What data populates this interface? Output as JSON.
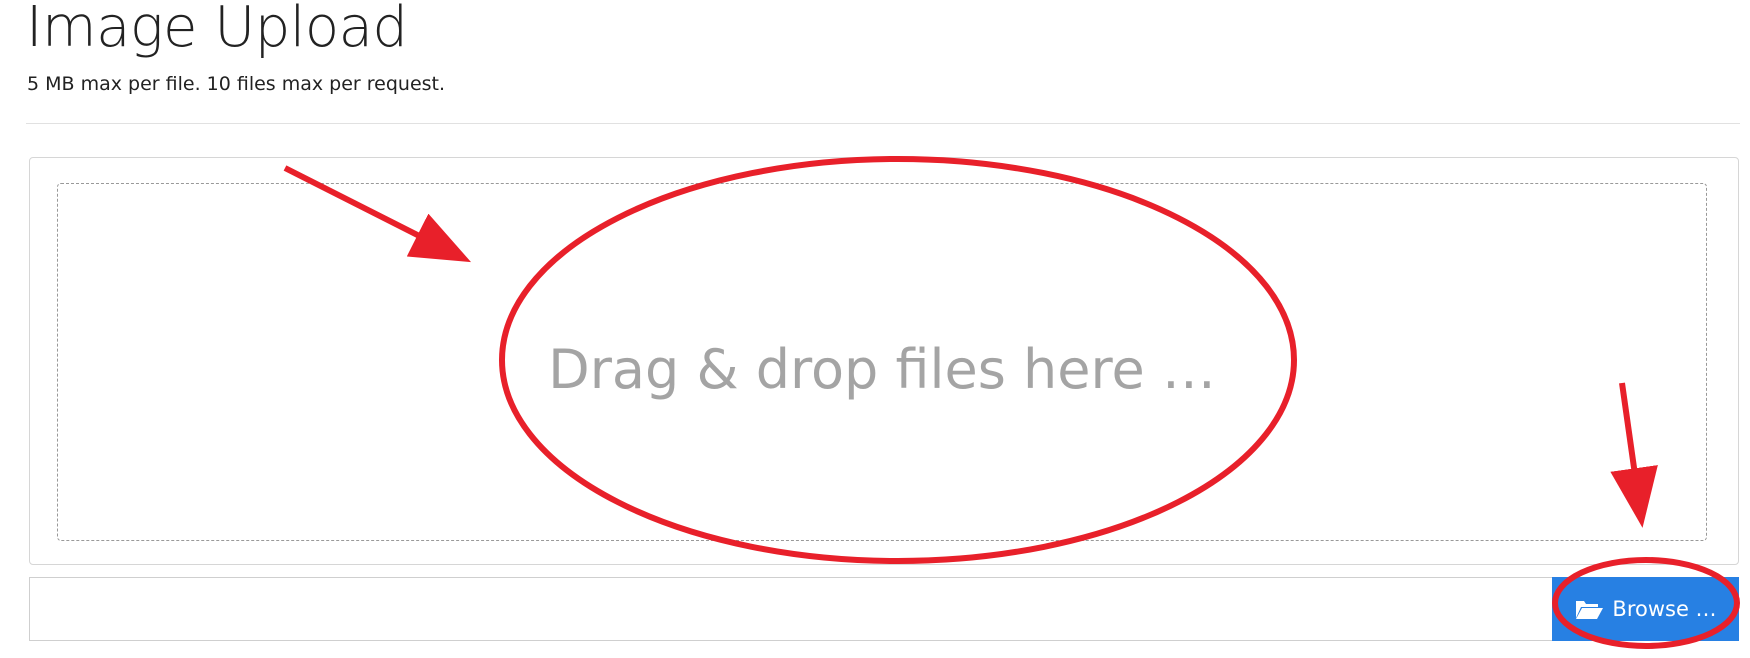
{
  "header": {
    "title": "Image Upload",
    "subtitle": "5 MB max per file. 10 files max per request."
  },
  "upload": {
    "drop_text": "Drag & drop files here …",
    "file_input_value": "",
    "browse_label": "Browse …",
    "browse_icon": "folder-open-icon"
  },
  "colors": {
    "browse_button": "#2780e3",
    "drop_text": "#a4a4a4",
    "annotation": "#e8202a"
  }
}
